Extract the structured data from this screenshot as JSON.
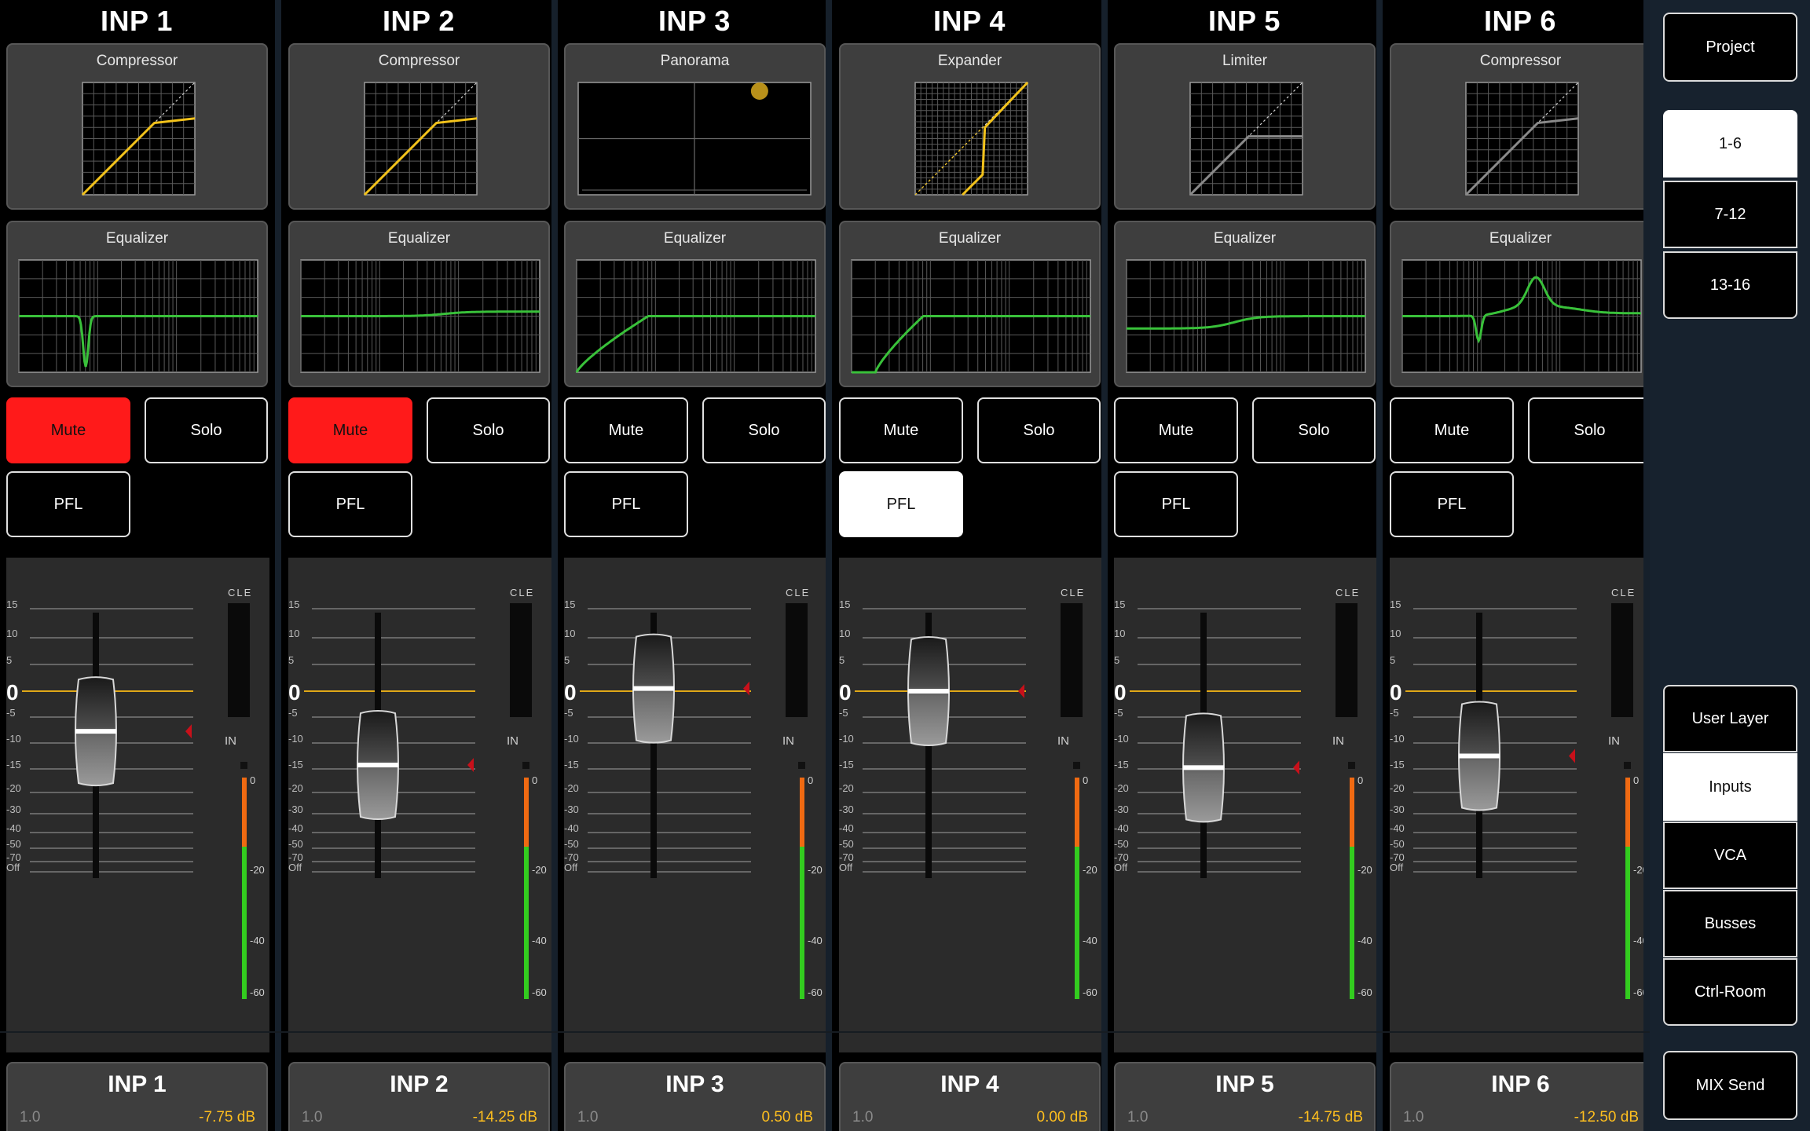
{
  "channels": [
    {
      "title": "INP 1",
      "dyn": {
        "label": "Compressor",
        "type": "compressor",
        "color": "#f2c21b"
      },
      "eq": {
        "label": "Equalizer",
        "type": "notch-low"
      },
      "mute": {
        "label": "Mute",
        "active": true
      },
      "solo": {
        "label": "Solo",
        "active": false
      },
      "pfl": {
        "label": "PFL",
        "active": false
      },
      "fader_db": -7.75,
      "meter_labels": [
        "CLE",
        "IN"
      ],
      "name": "INP 1",
      "number": "1.0",
      "gain": "-7.75 dB"
    },
    {
      "title": "INP 2",
      "dyn": {
        "label": "Compressor",
        "type": "compressor",
        "color": "#f2c21b"
      },
      "eq": {
        "label": "Equalizer",
        "type": "high-shelf"
      },
      "mute": {
        "label": "Mute",
        "active": true
      },
      "solo": {
        "label": "Solo",
        "active": false
      },
      "pfl": {
        "label": "PFL",
        "active": false
      },
      "fader_db": -14.25,
      "meter_labels": [
        "CLE",
        "IN"
      ],
      "name": "INP 2",
      "number": "1.0",
      "gain": "-14.25 dB"
    },
    {
      "title": "INP 3",
      "dyn": {
        "label": "Panorama",
        "type": "panorama",
        "color": "#b8901a"
      },
      "eq": {
        "label": "Equalizer",
        "type": "highpass"
      },
      "mute": {
        "label": "Mute",
        "active": false
      },
      "solo": {
        "label": "Solo",
        "active": false
      },
      "pfl": {
        "label": "PFL",
        "active": false
      },
      "fader_db": 0.5,
      "meter_labels": [
        "CLE",
        "IN"
      ],
      "name": "INP 3",
      "number": "1.0",
      "gain": "0.50 dB"
    },
    {
      "title": "INP 4",
      "dyn": {
        "label": "Expander",
        "type": "expander",
        "color": "#f2c21b"
      },
      "eq": {
        "label": "Equalizer",
        "type": "highpass2"
      },
      "mute": {
        "label": "Mute",
        "active": false
      },
      "solo": {
        "label": "Solo",
        "active": false
      },
      "pfl": {
        "label": "PFL",
        "active": true
      },
      "fader_db": 0.0,
      "meter_labels": [
        "CLE",
        "IN"
      ],
      "name": "INP 4",
      "number": "1.0",
      "gain": "0.00 dB"
    },
    {
      "title": "INP 5",
      "dyn": {
        "label": "Limiter",
        "type": "limiter",
        "color": "#8a8a8a"
      },
      "eq": {
        "label": "Equalizer",
        "type": "low-shelf"
      },
      "mute": {
        "label": "Mute",
        "active": false
      },
      "solo": {
        "label": "Solo",
        "active": false
      },
      "pfl": {
        "label": "PFL",
        "active": false
      },
      "fader_db": -14.75,
      "meter_labels": [
        "CLE",
        "IN"
      ],
      "name": "INP 5",
      "number": "1.0",
      "gain": "-14.75 dB"
    },
    {
      "title": "INP 6",
      "dyn": {
        "label": "Compressor",
        "type": "compressor-gray",
        "color": "#8a8a8a"
      },
      "eq": {
        "label": "Equalizer",
        "type": "peak-notch"
      },
      "mute": {
        "label": "Mute",
        "active": false
      },
      "solo": {
        "label": "Solo",
        "active": false
      },
      "pfl": {
        "label": "PFL",
        "active": false
      },
      "fader_db": -12.5,
      "meter_labels": [
        "CLE",
        "IN"
      ],
      "name": "INP 6",
      "number": "1.0",
      "gain": "-12.50 dB"
    }
  ],
  "fader_scale": {
    "ticks": [
      "15",
      "10",
      "5",
      "0",
      "-5",
      "-10",
      "-15",
      "-20",
      "-30",
      "-40",
      "-50",
      "-70",
      "Off"
    ],
    "meter_ticks": [
      "0",
      "-20",
      "-40",
      "-60"
    ]
  },
  "sidebar": {
    "project": "Project",
    "layers": [
      {
        "label": "1-6",
        "active": true
      },
      {
        "label": "7-12",
        "active": false
      },
      {
        "label": "13-16",
        "active": false
      }
    ],
    "views": [
      {
        "label": "User Layer",
        "active": false
      },
      {
        "label": "Inputs",
        "active": true
      },
      {
        "label": "VCA",
        "active": false
      },
      {
        "label": "Busses",
        "active": false
      },
      {
        "label": "Ctrl-Room",
        "active": false
      }
    ],
    "mix_send": "MIX Send"
  },
  "colors": {
    "accent": "#f2c21b",
    "mute_on": "#ff1a1a",
    "eq_curve": "#39c13a",
    "sidebar_bg": "#17222e",
    "gain_text": "#ffbf1e"
  }
}
